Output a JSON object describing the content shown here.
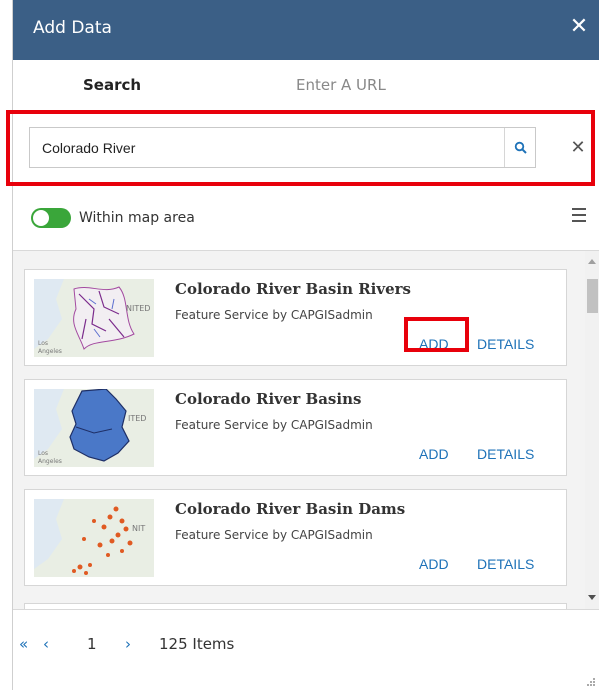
{
  "dialog": {
    "title": "Add Data",
    "close_glyph": "✕"
  },
  "tabs": [
    {
      "label": "Search",
      "active": true
    },
    {
      "label": "Enter A URL",
      "active": false
    }
  ],
  "search": {
    "value": "Colorado River",
    "placeholder": "",
    "clear_glyph": "✕"
  },
  "filter": {
    "toggle_on": true,
    "label": "Within map area"
  },
  "results": [
    {
      "name": "Colorado River Basin Rivers",
      "meta": "Feature Service by CAPGISadmin",
      "add": "ADD",
      "details": "DETAILS"
    },
    {
      "name": "Colorado River Basins",
      "meta": "Feature Service by CAPGISadmin",
      "add": "ADD",
      "details": "DETAILS"
    },
    {
      "name": "Colorado River Basin Dams",
      "meta": "Feature Service by CAPGISadmin",
      "add": "ADD",
      "details": "DETAILS"
    }
  ],
  "pager": {
    "first": "«",
    "prev": "‹",
    "page": "1",
    "next": "›",
    "count": "125 Items"
  },
  "colors": {
    "titlebar": "#3b5f86",
    "link": "#1e72b8",
    "toggle_on": "#3aa63a",
    "highlight": "#e8000b"
  }
}
